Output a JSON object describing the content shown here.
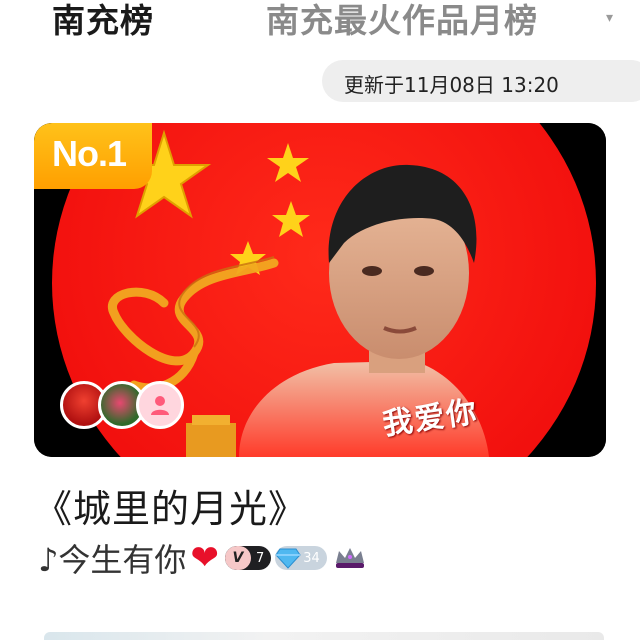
{
  "tabs": {
    "active": "南充榜",
    "inactive": "南充最火作品月榜",
    "caret": "▾"
  },
  "update": {
    "text": "更新于11月08日 13:20"
  },
  "banner": {
    "rank_label": "No.1",
    "overlay_text": "我爱你"
  },
  "song": {
    "title": "《城里的月光》"
  },
  "author": {
    "name": "♪今生有你",
    "heart": "❤",
    "vip_letter": "V",
    "vip_level": "7",
    "gem_level": "34"
  },
  "colors": {
    "accent_red": "#e8102a",
    "badge_orange": "#ffa800",
    "flag_red": "#ff1a1a",
    "star_gold": "#ffd21a"
  }
}
